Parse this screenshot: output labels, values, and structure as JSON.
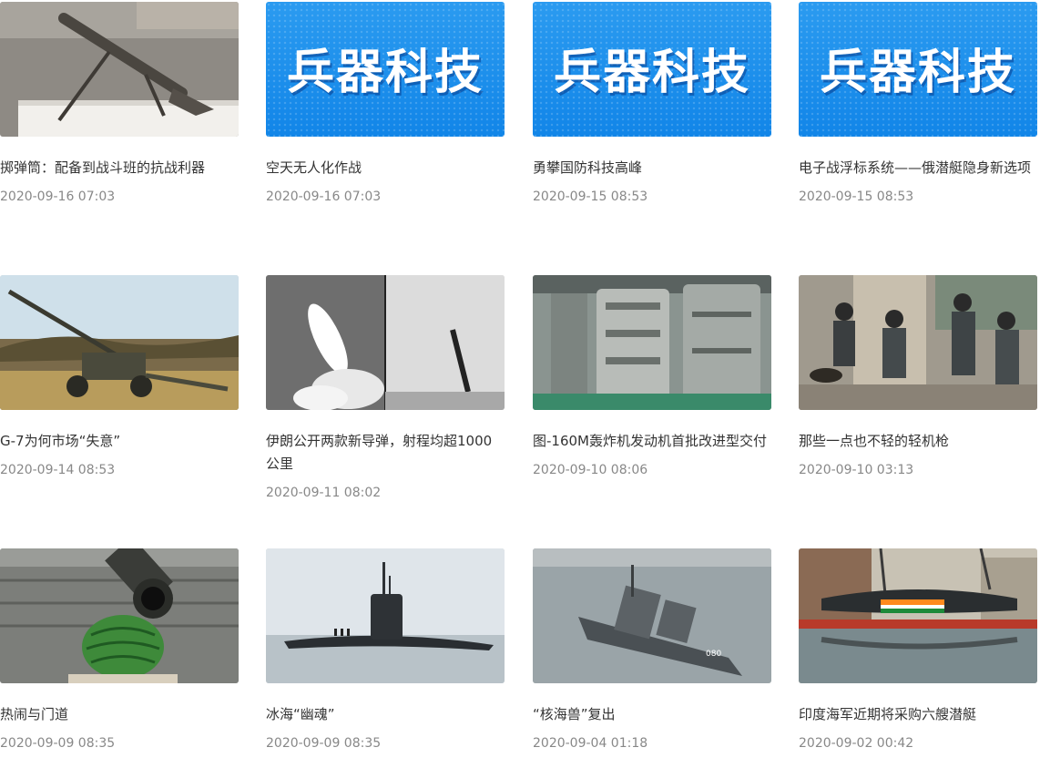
{
  "brand_banner_text": "兵器科技",
  "articles": [
    {
      "title": "掷弹筒：配备到战斗班的抗战利器",
      "date": "2020-09-16 07:03",
      "thumb": "mortar-photo"
    },
    {
      "title": "空天无人化作战",
      "date": "2020-09-16 07:03",
      "thumb": "brand-banner"
    },
    {
      "title": "勇攀国防科技高峰",
      "date": "2020-09-15 08:53",
      "thumb": "brand-banner"
    },
    {
      "title": "电子战浮标系统——俄潜艇隐身新选项",
      "date": "2020-09-15 08:53",
      "thumb": "brand-banner"
    },
    {
      "title": "G-7为何市场“失意”",
      "date": "2020-09-14 08:53",
      "thumb": "howitzer-photo"
    },
    {
      "title": "伊朗公开两款新导弹，射程均超1000公里",
      "date": "2020-09-11 08:02",
      "thumb": "missile-launch-photo"
    },
    {
      "title": "图-160M轰炸机发动机首批改进型交付",
      "date": "2020-09-10 08:06",
      "thumb": "engine-factory-photo"
    },
    {
      "title": "那些一点也不轻的轻机枪",
      "date": "2020-09-10 03:13",
      "thumb": "soldiers-photo"
    },
    {
      "title": "热闹与门道",
      "date": "2020-09-09 08:35",
      "thumb": "tank-barrel-watermelon-photo"
    },
    {
      "title": "冰海“幽魂”",
      "date": "2020-09-09 08:35",
      "thumb": "submarine-photo"
    },
    {
      "title": "“核海兽”复出",
      "date": "2020-09-04 01:18",
      "thumb": "battlecruiser-photo"
    },
    {
      "title": "印度海军近期将采购六艘潜艇",
      "date": "2020-09-02 00:42",
      "thumb": "submarine-dock-photo"
    }
  ]
}
